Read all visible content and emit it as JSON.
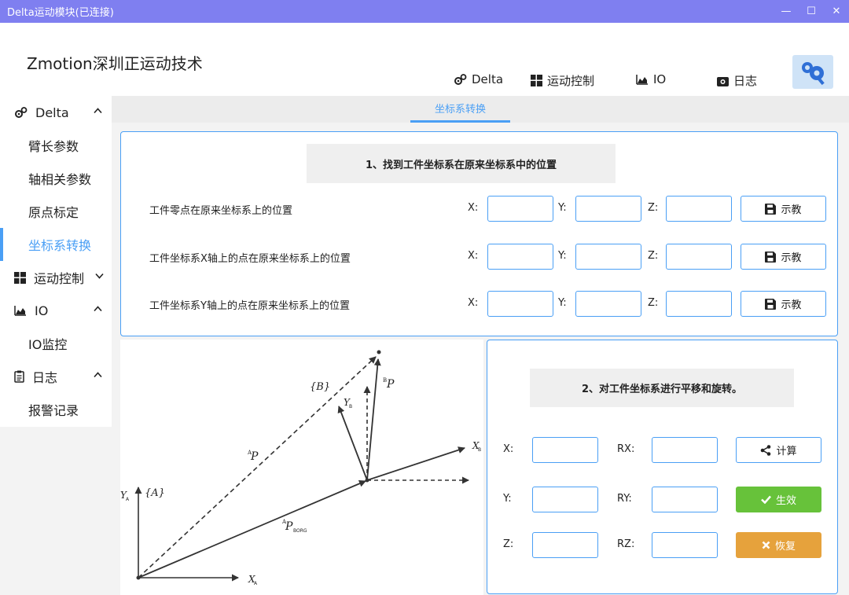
{
  "window": {
    "title": "Delta运动模块(已连接)",
    "minimize": "—",
    "maximize": "☐",
    "close": "✕"
  },
  "header": {
    "brand": "Zmotion深圳正运动技术"
  },
  "topnav": [
    {
      "label": "Delta",
      "icon": "gears-icon"
    },
    {
      "label": "运动控制",
      "icon": "windows-icon"
    },
    {
      "label": "IO",
      "icon": "area-chart-icon"
    },
    {
      "label": "日志",
      "icon": "camera-icon"
    }
  ],
  "sidebar": {
    "groups": [
      {
        "label": "Delta",
        "icon": "gears-icon",
        "expanded": true,
        "items": [
          "臂长参数",
          "轴相关参数",
          "原点标定",
          "坐标系转换"
        ],
        "active": "坐标系转换"
      },
      {
        "label": "运动控制",
        "icon": "windows-icon",
        "expanded": false,
        "items": []
      },
      {
        "label": "IO",
        "icon": "area-chart-icon",
        "expanded": true,
        "items": [
          "IO监控"
        ]
      },
      {
        "label": "日志",
        "icon": "clipboard-icon",
        "expanded": true,
        "items": [
          "报警记录"
        ]
      }
    ]
  },
  "tabs": [
    {
      "label": "坐标系转换",
      "active": true
    }
  ],
  "section1": {
    "title": "1、找到工件坐标系在原来坐标系中的位置",
    "rows": [
      {
        "label": "工件零点在原来坐标系上的位置",
        "x": "",
        "y": "",
        "z": "",
        "button": "示教"
      },
      {
        "label": "工件坐标系X轴上的点在原来坐标系上的位置",
        "x": "",
        "y": "",
        "z": "",
        "button": "示教"
      },
      {
        "label": "工件坐标系Y轴上的点在原来坐标系上的位置",
        "x": "",
        "y": "",
        "z": "",
        "button": "示教"
      }
    ],
    "axis_labels": {
      "x": "X:",
      "y": "Y:",
      "z": "Z:"
    }
  },
  "section2": {
    "title": "2、对工件坐标系进行平移和旋转。",
    "labels": {
      "x": "X:",
      "y": "Y:",
      "z": "Z:",
      "rx": "RX:",
      "ry": "RY:",
      "rz": "RZ:"
    },
    "values": {
      "x": "",
      "y": "",
      "z": "",
      "rx": "",
      "ry": "",
      "rz": ""
    },
    "buttons": {
      "calc": "计算",
      "apply": "生效",
      "restore": "恢复"
    }
  },
  "diagram": {
    "labels": {
      "frame_b": "{B}",
      "frame_a": "{A}",
      "bp": "P",
      "bp_sup": "B",
      "ap": "P",
      "ap_sup": "A",
      "porg": "P",
      "porg_sup": "A",
      "porg_sub": "BORG",
      "ya": "Y",
      "ya_sub": "A",
      "yb": "Y",
      "yb_sub": "B",
      "xa": "X",
      "xa_sub": "A",
      "xb": "X",
      "xb_sub": "B"
    }
  },
  "colors": {
    "accent": "#4a9ff5",
    "titlebar": "#7f7ff0",
    "green": "#67c23a",
    "orange": "#e6a23c"
  }
}
